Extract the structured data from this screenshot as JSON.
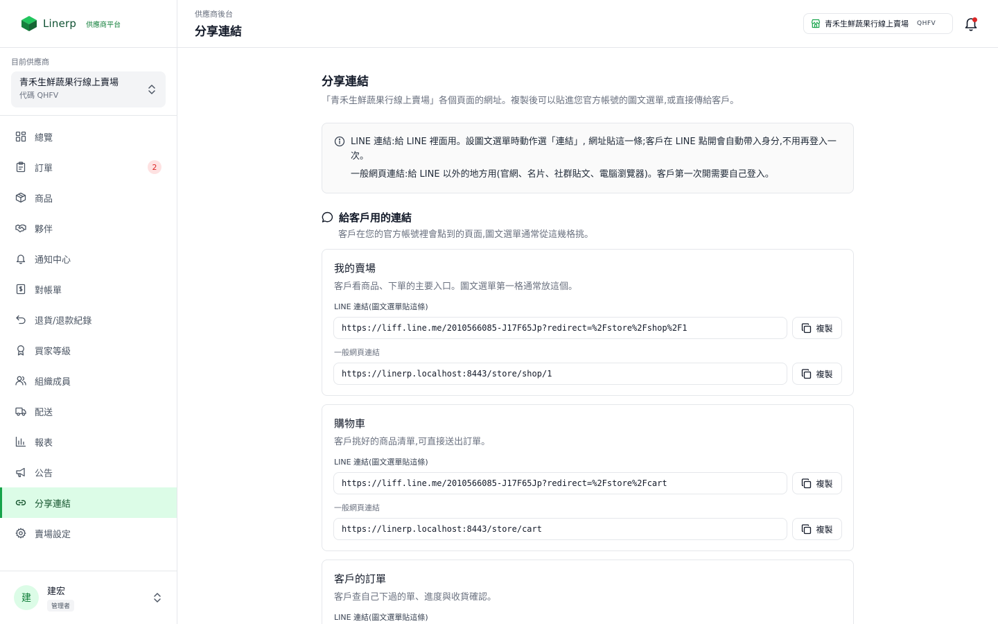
{
  "brand": {
    "name": "Linerp",
    "tag": "供應商平台"
  },
  "supplier": {
    "caption": "目前供應商",
    "name": "青禾生鮮蔬果行線上賣場",
    "code": "代碼 QHFV"
  },
  "nav": {
    "items": [
      {
        "label": "總覽",
        "icon": "dashboard-icon"
      },
      {
        "label": "訂單",
        "icon": "clipboard-icon",
        "badge": "2"
      },
      {
        "label": "商品",
        "icon": "package-icon"
      },
      {
        "label": "夥伴",
        "icon": "handshake-icon"
      },
      {
        "label": "通知中心",
        "icon": "bell-icon"
      },
      {
        "label": "對帳單",
        "icon": "receipt-icon"
      },
      {
        "label": "退貨/退款紀錄",
        "icon": "undo-icon"
      },
      {
        "label": "買家等級",
        "icon": "award-icon"
      },
      {
        "label": "組織成員",
        "icon": "users-icon"
      },
      {
        "label": "配送",
        "icon": "truck-icon"
      },
      {
        "label": "報表",
        "icon": "bar-chart-icon"
      },
      {
        "label": "公告",
        "icon": "megaphone-icon"
      },
      {
        "label": "分享連結",
        "icon": "link-icon",
        "active": true
      },
      {
        "label": "賣場設定",
        "icon": "settings-icon"
      }
    ]
  },
  "user": {
    "avatar": "建",
    "name": "建宏",
    "role": "管理者"
  },
  "topbar": {
    "breadcrumb": "供應商後台",
    "title": "分享連結",
    "store_name": "青禾生鮮蔬果行線上賣場",
    "store_code": "QHFV"
  },
  "page": {
    "title": "分享連結",
    "description": "「青禾生鮮蔬果行線上賣場」各個頁面的網址。複製後可以貼進您官方帳號的圖文選單,或直接傳給客戶。",
    "info_line1": "LINE 連結:給 LINE 裡面用。設圖文選單時動作選「連結」, 網址貼這一條;客戶在 LINE 點開會自動帶入身分,不用再登入一次。",
    "info_line2": "一般網頁連結:給 LINE 以外的地方用(官網、名片、社群貼文、電腦瀏覽器)。客戶第一次開需要自己登入。"
  },
  "section": {
    "title": "給客戶用的連結",
    "description": "客戶在您的官方帳號裡會點到的頁面,圖文選單通常從這幾格挑。"
  },
  "labels": {
    "line": "LINE 連結(圖文選單貼這條)",
    "web": "一般網頁連結",
    "copy": "複製"
  },
  "cards": [
    {
      "title": "我的賣場",
      "description": "客戶看商品、下單的主要入口。圖文選單第一格通常放這個。",
      "line_url": "https://liff.line.me/2010566085-J17F65Jp?redirect=%2Fstore%2Fshop%2F1",
      "web_url": "https://linerp.localhost:8443/store/shop/1"
    },
    {
      "title": "購物車",
      "description": "客戶挑好的商品清單,可直接送出訂單。",
      "line_url": "https://liff.line.me/2010566085-J17F65Jp?redirect=%2Fstore%2Fcart",
      "web_url": "https://linerp.localhost:8443/store/cart"
    },
    {
      "title": "客戶的訂單",
      "description": "客戶查自己下過的單、進度與收貨確認。"
    }
  ],
  "colors": {
    "accent": "#16a34a",
    "active_bg": "#dcfce7",
    "badge": "#dc2626"
  }
}
